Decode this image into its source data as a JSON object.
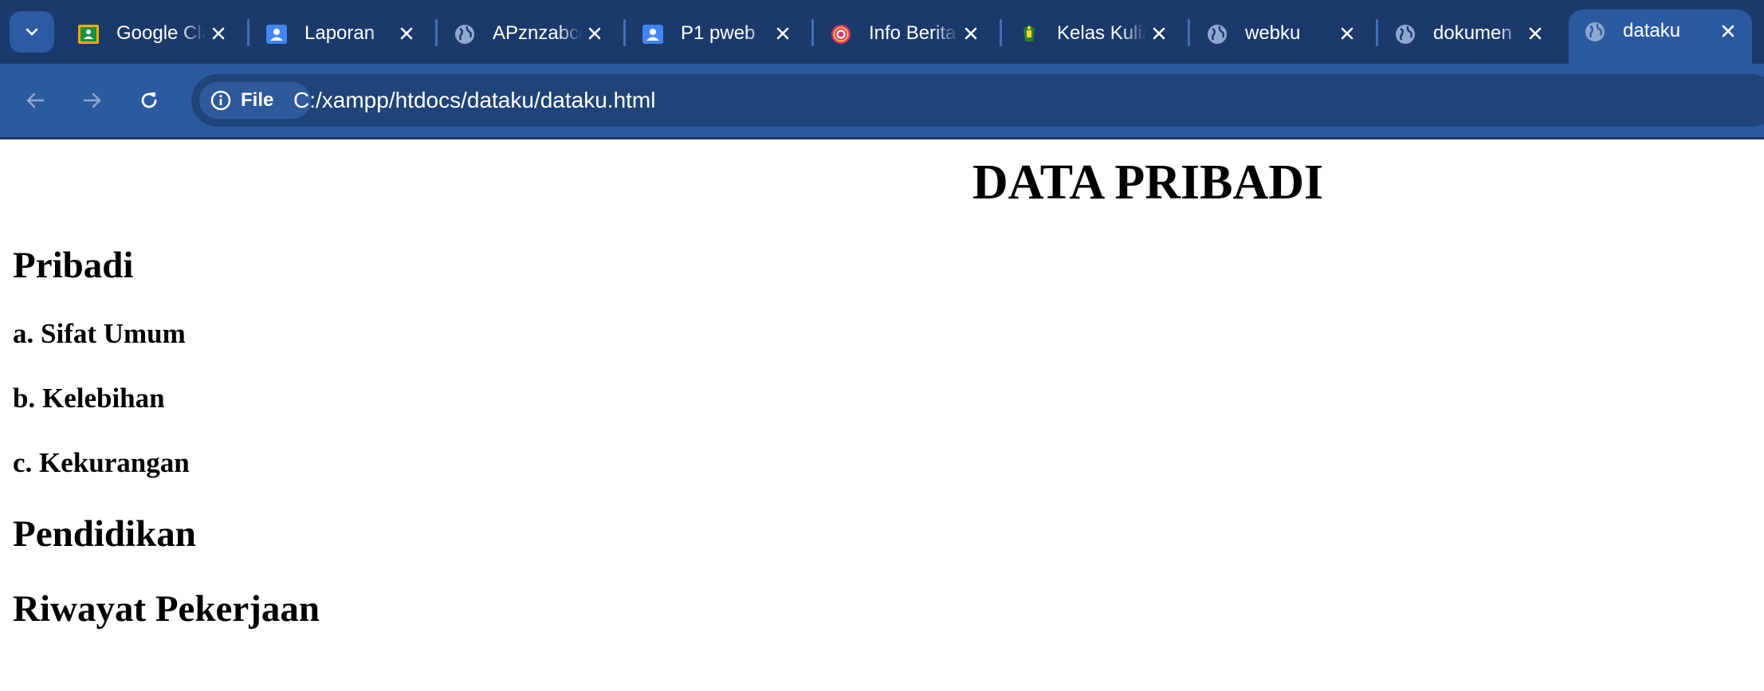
{
  "tabs": [
    {
      "title": "Google Classroom",
      "favicon": "google-classroom-icon"
    },
    {
      "title": "Laporan",
      "favicon": "google-meet-icon"
    },
    {
      "title": "APznzabcdef",
      "favicon": "globe-icon"
    },
    {
      "title": "P1 pweb",
      "favicon": "google-meet-icon"
    },
    {
      "title": "Info Berita",
      "favicon": "instagram-icon"
    },
    {
      "title": "Kelas Kuliah",
      "favicon": "campus-logo-icon"
    },
    {
      "title": "webku",
      "favicon": "globe-icon"
    },
    {
      "title": "dokumen",
      "favicon": "globe-icon"
    },
    {
      "title": "dataku",
      "favicon": "globe-icon",
      "active": true
    }
  ],
  "omnibox": {
    "chip_label": "File",
    "url": "C:/xampp/htdocs/dataku/dataku.html"
  },
  "page": {
    "title": "DATA PRIBADI",
    "sections": [
      {
        "heading": "Pribadi"
      },
      {
        "heading": "a. Sifat Umum"
      },
      {
        "heading": "b. Kelebihan"
      },
      {
        "heading": "c. Kekurangan"
      },
      {
        "heading": "Pendidikan"
      },
      {
        "heading": "Riwayat Pekerjaan"
      }
    ]
  },
  "colors": {
    "tabstrip": "#1b3a6b",
    "toolbar": "#2c5aa0",
    "omnibox": "#1f4478",
    "text": "#000000"
  }
}
